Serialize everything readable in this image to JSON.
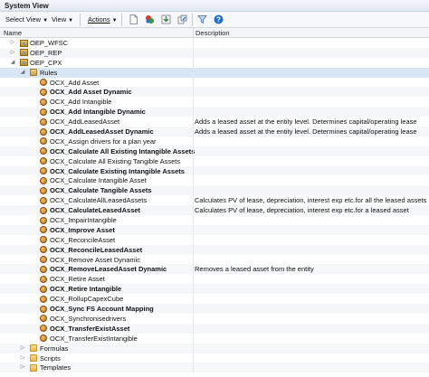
{
  "window": {
    "title": "System View"
  },
  "toolbar": {
    "select_view": "Select View",
    "view": "View",
    "actions": "Actions"
  },
  "columns": {
    "name": "Name",
    "description": "Description"
  },
  "tree": [
    {
      "label": "OEP_WFSC",
      "level": 1,
      "icon": "application-icon",
      "expander": "collapsed",
      "desc": ""
    },
    {
      "label": "OEP_REP",
      "level": 1,
      "icon": "application-icon",
      "expander": "collapsed",
      "desc": ""
    },
    {
      "label": "OEP_CPX",
      "level": 1,
      "icon": "application-icon",
      "expander": "expanded",
      "desc": ""
    },
    {
      "label": "Rules",
      "level": 2,
      "icon": "rules-folder-icon",
      "expander": "expanded",
      "desc": "",
      "selected": true
    },
    {
      "label": "OCX_Add Asset",
      "level": 3,
      "icon": "rule-icon",
      "bold": false,
      "desc": ""
    },
    {
      "label": "OCX_Add Asset Dynamic",
      "level": 3,
      "icon": "rule-icon",
      "bold": true,
      "desc": ""
    },
    {
      "label": "OCX_Add Intangible",
      "level": 3,
      "icon": "rule-icon",
      "bold": false,
      "desc": ""
    },
    {
      "label": "OCX_Add Intangible Dynamic",
      "level": 3,
      "icon": "rule-icon",
      "bold": true,
      "desc": ""
    },
    {
      "label": "OCX_AddLeasedAsset",
      "level": 3,
      "icon": "rule-icon",
      "bold": false,
      "desc": "Adds a leased asset at the entity level. Determines capital/operating lease"
    },
    {
      "label": "OCX_AddLeasedAsset Dynamic",
      "level": 3,
      "icon": "rule-icon",
      "bold": true,
      "desc": "Adds a leased asset at the entity level. Determines capital/operating lease"
    },
    {
      "label": "OCX_Assign drivers for a plan year",
      "level": 3,
      "icon": "rule-icon",
      "bold": false,
      "desc": ""
    },
    {
      "label": "OCX_Calculate All Existing Intangible Assets",
      "level": 3,
      "icon": "rule-icon",
      "bold": true,
      "desc": ""
    },
    {
      "label": "OCX_Calculate All Existing Tangible Assets",
      "level": 3,
      "icon": "rule-icon",
      "bold": false,
      "desc": ""
    },
    {
      "label": "OCX_Calculate Existing Intangible Assets",
      "level": 3,
      "icon": "rule-icon",
      "bold": true,
      "desc": ""
    },
    {
      "label": "OCX_Calculate Intangible Asset",
      "level": 3,
      "icon": "rule-icon",
      "bold": false,
      "desc": ""
    },
    {
      "label": "OCX_Calculate Tangible Assets",
      "level": 3,
      "icon": "rule-icon",
      "bold": true,
      "desc": ""
    },
    {
      "label": "OCX_CalculateAllLeasedAssets",
      "level": 3,
      "icon": "rule-icon",
      "bold": false,
      "desc": "Calculates PV of lease, depreciation, interest exp etc.for all the leased assets"
    },
    {
      "label": "OCX_CalculateLeasedAsset",
      "level": 3,
      "icon": "rule-icon",
      "bold": true,
      "desc": "Calculates PV of lease, depreciation, interest exp etc.for a leased asset"
    },
    {
      "label": "OCX_ImpairIntangible",
      "level": 3,
      "icon": "rule-icon",
      "bold": false,
      "desc": ""
    },
    {
      "label": "OCX_Improve Asset",
      "level": 3,
      "icon": "rule-icon",
      "bold": true,
      "desc": ""
    },
    {
      "label": "OCX_ReconcileAsset",
      "level": 3,
      "icon": "rule-icon",
      "bold": false,
      "desc": ""
    },
    {
      "label": "OCX_ReconcileLeasedAsset",
      "level": 3,
      "icon": "rule-icon",
      "bold": true,
      "desc": ""
    },
    {
      "label": "OCX_Remove Asset Dynamic",
      "level": 3,
      "icon": "rule-icon",
      "bold": false,
      "desc": ""
    },
    {
      "label": "OCX_RemoveLeasedAsset Dynamic",
      "level": 3,
      "icon": "rule-icon",
      "bold": true,
      "desc": "Removes a leased asset from the entity"
    },
    {
      "label": "OCX_Retire Asset",
      "level": 3,
      "icon": "rule-icon",
      "bold": false,
      "desc": ""
    },
    {
      "label": "OCX_Retire Intangible",
      "level": 3,
      "icon": "rule-icon",
      "bold": true,
      "desc": ""
    },
    {
      "label": "OCX_RollupCapexCube",
      "level": 3,
      "icon": "rule-icon",
      "bold": false,
      "desc": ""
    },
    {
      "label": "OCX_Sync FS Account Mapping",
      "level": 3,
      "icon": "rule-icon",
      "bold": true,
      "desc": ""
    },
    {
      "label": "OCX_Synchronisedrivers",
      "level": 3,
      "icon": "rule-icon",
      "bold": false,
      "desc": ""
    },
    {
      "label": "OCX_TransferExistAsset",
      "level": 3,
      "icon": "rule-icon",
      "bold": true,
      "desc": ""
    },
    {
      "label": "OCX_TransferExistIntangible",
      "level": 3,
      "icon": "rule-icon",
      "bold": false,
      "desc": ""
    },
    {
      "label": "Formulas",
      "level": 2,
      "icon": "folder-icon",
      "expander": "collapsed",
      "desc": ""
    },
    {
      "label": "Scripts",
      "level": 2,
      "icon": "folder-icon",
      "expander": "collapsed",
      "desc": ""
    },
    {
      "label": "Templates",
      "level": 2,
      "icon": "folder-icon",
      "expander": "collapsed",
      "desc": ""
    }
  ]
}
